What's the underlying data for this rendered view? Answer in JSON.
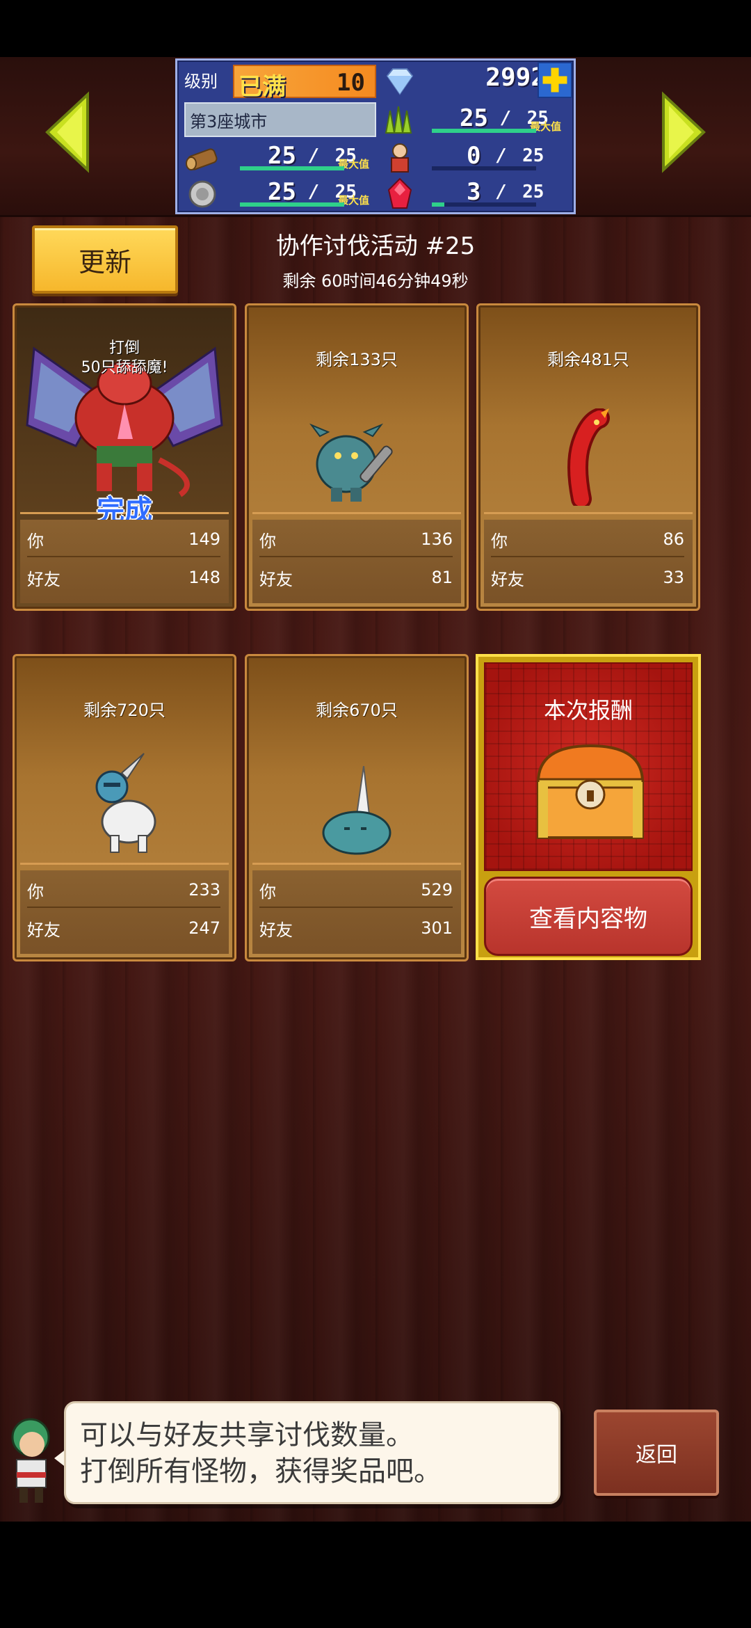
{
  "status_panel": {
    "level_label": "级别",
    "level_full": "已满",
    "level_value": "10",
    "gems": "2992",
    "city": "第3座城市",
    "wood_current": "25",
    "wood_max": "25",
    "stone_current": "25",
    "stone_max": "25",
    "grass_current": "25",
    "grass_max": "25",
    "worker_current": "0",
    "worker_max": "25",
    "ruby_current": "3",
    "ruby_max": "25",
    "max_tag": "最大值",
    "wood_fill": 1.0,
    "stone_fill": 1.0,
    "grass_fill": 1.0,
    "worker_fill": 0.0,
    "ruby_fill": 0.12
  },
  "header": {
    "refresh_label": "更新",
    "event_title": "协作讨伐活动 #25",
    "timer": "剩余 60时间46分钟49秒"
  },
  "cards": [
    {
      "label": "打倒",
      "label2": "50只舔舔魔!",
      "done_label": "完成",
      "you_label": "你",
      "you": "149",
      "friend_label": "好友",
      "friend": "148",
      "monster": "winged-demon"
    },
    {
      "label": "剩余133只",
      "you_label": "你",
      "you": "136",
      "friend_label": "好友",
      "friend": "81",
      "monster": "ogre"
    },
    {
      "label": "剩余481只",
      "you_label": "你",
      "you": "86",
      "friend_label": "好友",
      "friend": "33",
      "monster": "red-worm"
    },
    {
      "label": "剩余720只",
      "you_label": "你",
      "you": "233",
      "friend_label": "好友",
      "friend": "247",
      "monster": "armored-knight"
    },
    {
      "label": "剩余670只",
      "you_label": "你",
      "you": "529",
      "friend_label": "好友",
      "friend": "301",
      "monster": "horned-slime"
    }
  ],
  "reward": {
    "title": "本次报酬",
    "button": "查看内容物"
  },
  "dialog": {
    "line1": "可以与好友共享讨伐数量。",
    "line2": "打倒所有怪物，获得奖品吧。"
  },
  "back_label": "返回",
  "colors": {
    "accent_yellow": "#ffd95a",
    "panel_blue": "#2e3e8c",
    "bar_green": "#2fd08a",
    "reward_red": "#b8342c",
    "done_blue": "#2f6cff"
  }
}
